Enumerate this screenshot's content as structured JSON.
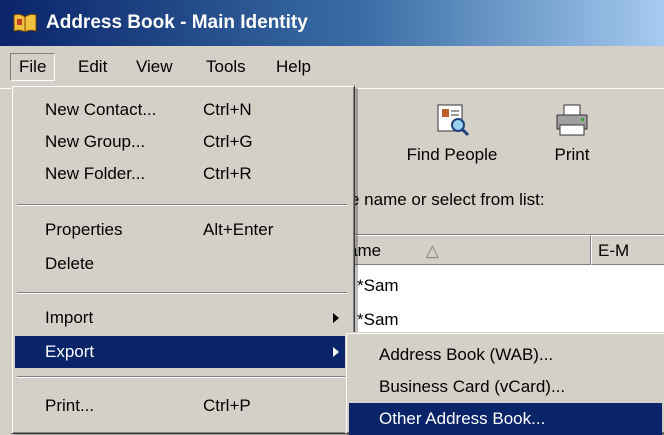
{
  "window": {
    "title": "Address Book - Main Identity"
  },
  "menubar": {
    "items": [
      "File",
      "Edit",
      "View",
      "Tools",
      "Help"
    ]
  },
  "toolbar": {
    "find_people": "Find People",
    "print": "Print"
  },
  "search": {
    "prompt": "e name or select from list:"
  },
  "list": {
    "columns": [
      "ame",
      "E-M"
    ],
    "sort_indicator": "△",
    "rows": [
      "*Sam",
      "*Sam"
    ]
  },
  "file_menu": {
    "new_contact": {
      "label": "New Contact...",
      "shortcut": "Ctrl+N"
    },
    "new_group": {
      "label": "New Group...",
      "shortcut": "Ctrl+G"
    },
    "new_folder": {
      "label": "New Folder...",
      "shortcut": "Ctrl+R"
    },
    "properties": {
      "label": "Properties",
      "shortcut": "Alt+Enter"
    },
    "delete": {
      "label": "Delete"
    },
    "import": {
      "label": "Import"
    },
    "export": {
      "label": "Export"
    },
    "print": {
      "label": "Print...",
      "shortcut": "Ctrl+P"
    }
  },
  "export_submenu": {
    "items": [
      "Address Book (WAB)...",
      "Business Card (vCard)...",
      "Other Address Book..."
    ]
  },
  "colors": {
    "highlight": "#0a246a",
    "face": "#d4d0c8"
  }
}
